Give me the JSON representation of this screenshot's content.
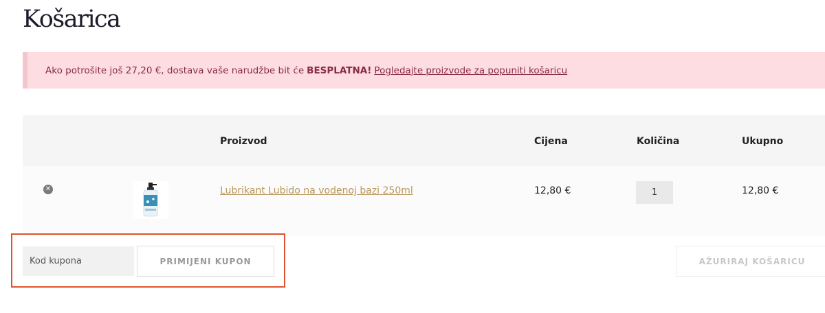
{
  "page": {
    "title": "Košarica"
  },
  "notice": {
    "text_before": "Ako potrošite još 27,20 €, dostava vaše narudžbe bit će",
    "bold": "BESPLATNA!",
    "link": "Pogledajte proizvode za popuniti košaricu"
  },
  "cart": {
    "headers": {
      "product": "Proizvod",
      "price": "Cijena",
      "quantity": "Količina",
      "total": "Ukupno"
    },
    "items": [
      {
        "remove_icon": "close-circle-icon",
        "name": "Lubrikant Lubido na vodenoj bazi 250ml",
        "price": "12,80 €",
        "quantity": "1",
        "total": "12,80 €"
      }
    ]
  },
  "coupon": {
    "placeholder": "Kod kupona",
    "apply_label": "PRIMIJENI KUPON"
  },
  "update_label": "AŽURIRAJ KOŠARICU",
  "colors": {
    "notice_bg": "#fddde2",
    "notice_text": "#8a2a48",
    "link": "#b9965a",
    "highlight": "#e0522b"
  }
}
